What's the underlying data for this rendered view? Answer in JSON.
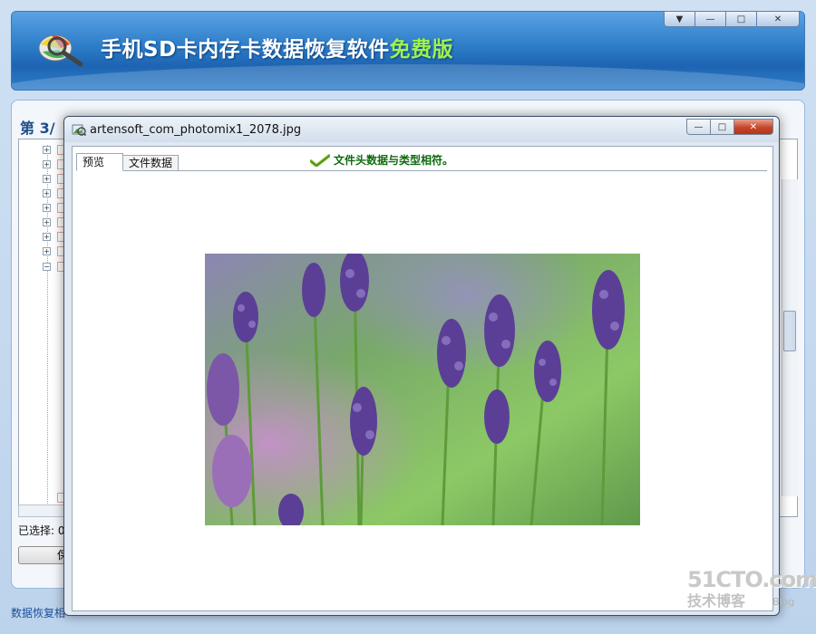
{
  "app": {
    "title_main": "手机SD卡内存卡数据恢复软件",
    "title_free": "免费版",
    "logo_icon": "magnifier-disk-icon"
  },
  "window_controls": [
    "▼",
    "—",
    "□",
    "✕"
  ],
  "step": {
    "label": "第 3/",
    "faded_text": "· · · · · · · · · ·"
  },
  "tree": {
    "expander_collapsed": "+",
    "expander_expanded": "−"
  },
  "selected_label": "已选择: 0",
  "save_button": "保",
  "status_text": "数据恢复相",
  "preview_dialog": {
    "title": "artensoft_com_photomix1_2078.jpg",
    "controls": [
      "—",
      "□",
      "✕"
    ],
    "tabs": [
      "预览",
      "文件数据"
    ],
    "status_message": "文件头数据与类型相符。",
    "status_color": "#0e6a0e",
    "image_description": "lavender-flowers-photo"
  },
  "watermark": {
    "main": "51CTO.com",
    "sub": "技术博客",
    "blog": "Blog"
  }
}
